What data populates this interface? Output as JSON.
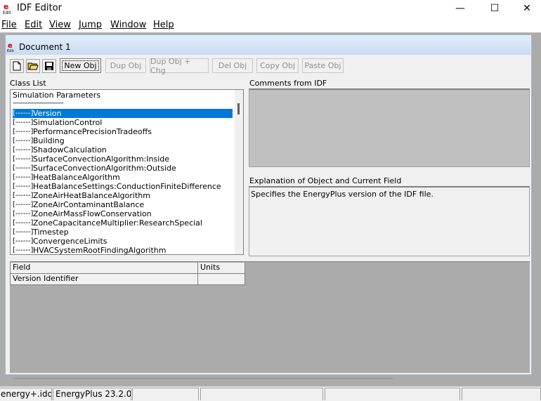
{
  "window": {
    "title": "IDF Editor",
    "minimize": "—",
    "maximize": "☐",
    "close": "✕"
  },
  "menu": [
    "File",
    "Edit",
    "View",
    "Jump",
    "Window",
    "Help"
  ],
  "document": {
    "title": "Document 1"
  },
  "toolbar": {
    "buttons": [
      "New Obj",
      "Dup Obj",
      "Dup Obj + Chg",
      "Del Obj",
      "Copy Obj",
      "Paste Obj"
    ],
    "icons": [
      "new-file-icon",
      "open-folder-icon",
      "save-disk-icon"
    ]
  },
  "class_list": {
    "label": "Class List",
    "group": "Simulation Parameters",
    "separator": "--------------------------------",
    "bracket": "[------]",
    "items": [
      "Version",
      "SimulationControl",
      "PerformancePrecisionTradeoffs",
      "Building",
      "ShadowCalculation",
      "SurfaceConvectionAlgorithm:Inside",
      "SurfaceConvectionAlgorithm:Outside",
      "HeatBalanceAlgorithm",
      "HeatBalanceSettings:ConductionFiniteDifference",
      "ZoneAirHeatBalanceAlgorithm",
      "ZoneAirContaminantBalance",
      "ZoneAirMassFlowConservation",
      "ZoneCapacitanceMultiplier:ResearchSpecial",
      "Timestep",
      "ConvergenceLimits",
      "HVACSystemRootFindingAlgorithm"
    ],
    "selected": "Version"
  },
  "comments": {
    "label": "Comments from IDF"
  },
  "explanation": {
    "label": "Explanation of Object and Current Field",
    "text": "Specifies the EnergyPlus version of the IDF file."
  },
  "field_grid": {
    "headers": [
      "Field",
      "Units"
    ],
    "rows": [
      [
        "Version Identifier",
        ""
      ]
    ]
  },
  "status_bar": [
    "energy+.idd",
    "EnergyPlus 23.2.0",
    "",
    "",
    "",
    ""
  ],
  "colors": {
    "selection": "#0078d7",
    "mdi_background": "#ababab",
    "doc_titlebar": "#c7dbf3"
  }
}
